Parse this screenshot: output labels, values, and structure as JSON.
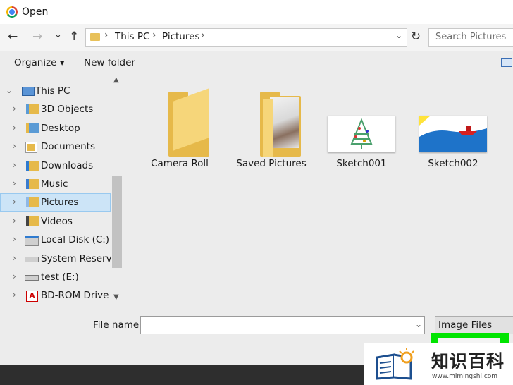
{
  "window": {
    "title": "Open"
  },
  "navbar": {
    "back_glyph": "←",
    "forward_glyph": "→",
    "recent_glyph": "⌄",
    "up_glyph": "↑",
    "breadcrumb": [
      "This PC",
      "Pictures"
    ],
    "sep_glyph": "›",
    "dropdown_glyph": "⌄",
    "refresh_glyph": "↻",
    "search_placeholder": "Search Pictures"
  },
  "toolbar": {
    "organize_label": "Organize ▾",
    "new_folder_label": "New folder"
  },
  "sidebar": {
    "root_label": "This PC",
    "items": [
      {
        "label": "3D Objects",
        "icon": "3d-objects-icon"
      },
      {
        "label": "Desktop",
        "icon": "desktop-icon"
      },
      {
        "label": "Documents",
        "icon": "documents-icon"
      },
      {
        "label": "Downloads",
        "icon": "downloads-icon"
      },
      {
        "label": "Music",
        "icon": "music-icon"
      },
      {
        "label": "Pictures",
        "icon": "pictures-icon",
        "selected": true
      },
      {
        "label": "Videos",
        "icon": "videos-icon"
      },
      {
        "label": "Local Disk (C:)",
        "icon": "local-disk-icon"
      },
      {
        "label": "System Reserved",
        "icon": "drive-icon"
      },
      {
        "label": "test (E:)",
        "icon": "drive-icon"
      },
      {
        "label": "BD-ROM Drive (",
        "icon": "bd-rom-icon"
      }
    ]
  },
  "content": {
    "items": [
      {
        "label": "Camera Roll",
        "kind": "folder"
      },
      {
        "label": "Saved Pictures",
        "kind": "folder-with-photo"
      },
      {
        "label": "Sketch001",
        "kind": "image"
      },
      {
        "label": "Sketch002",
        "kind": "image"
      }
    ]
  },
  "bottom": {
    "file_name_label": "File name:",
    "file_name_value": "",
    "file_type": "Image Files"
  },
  "watermark": {
    "text": "知识百科",
    "url": "www.mimingshi.com"
  },
  "colors": {
    "selection": "#cce4f7",
    "highlight": "#00e400",
    "folder": "#e6b94a"
  }
}
